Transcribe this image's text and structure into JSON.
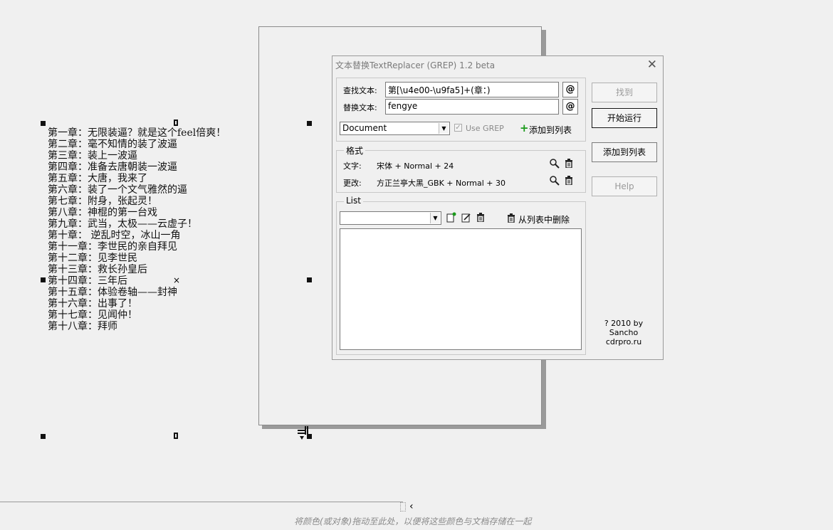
{
  "chapters": [
    "第一章：无限装逼？就是这个feel倍爽！",
    "第二章：毫不知情的装了波逼",
    "第三章：装上一波逼",
    "第四章：准备去唐朝装一波逼",
    "第五章：大唐，我来了",
    "第六章：装了一个文气雅然的逼",
    "第七章：附身，张起灵！",
    "第八章：神棍的第一台戏",
    "第九章：武当，太极——云虚子！",
    "第十章： 逆乱时空，冰山一角",
    "第十一章：李世民的亲自拜见",
    "第十二章：见李世民",
    "第十三章：救长孙皇后",
    "第十四章：三年后",
    "第十五章：体验卷轴——封神",
    "第十六章：出事了！",
    "第十七章：见闻仲！",
    "第十八章：拜师"
  ],
  "canvas": {
    "center_mark": "×"
  },
  "dialog": {
    "title": "文本替换TextReplacer (GREP) 1.2 beta",
    "close_glyph": "✕",
    "find_label": "查找文本:",
    "find_value": "第[\\u4e00-\\u9fa5]+(章：)",
    "replace_label": "替换文本:",
    "replace_value": "fengye",
    "at_glyph": "@",
    "scope_value": "Document",
    "use_grep_label": "Use GREP",
    "add_to_list_label": "添加到列表",
    "format_group_label": "格式",
    "text_label": "文字:",
    "text_value": "宋体 + Normal + 24",
    "change_label": "更改:",
    "change_value": "方正兰亭大黑_GBK + Normal + 30",
    "list_group_label": "List",
    "remove_from_list_label": "从列表中删除",
    "buttons": {
      "find": "找到",
      "run": "开始运行",
      "add_to_list": "添加到列表",
      "help": "Help"
    },
    "credit_line1": "? 2010 by Sancho",
    "credit_line2": "cdrpro.ru"
  },
  "palette": {
    "arrow": "‹",
    "hint": "将颜色(或对象)拖动至此处，以便将这些颜色与文档存储在一起"
  }
}
